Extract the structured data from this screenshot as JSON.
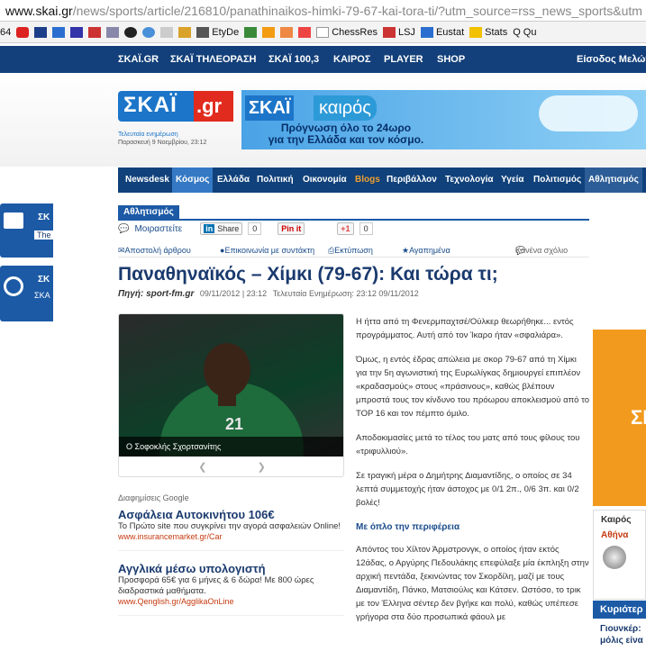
{
  "browser": {
    "url_host": "www.skai.gr",
    "url_path": "/news/sports/article/216810/panathinaikos-himki-79-67-kai-tora-ti/?utm_source=rss_news_sports&utm",
    "bookmarks": [
      "64",
      "EtyDe",
      "ChessRes",
      "LSJ",
      "Eustat",
      "Stats",
      "Qu"
    ]
  },
  "topnav": {
    "items": [
      "ΣΚΑΪ.GR",
      "ΣΚΑΪ ΤΗΛΕΟΡΑΣΗ",
      "ΣΚΑΪ 100,3",
      "ΚΑΙΡΟΣ",
      "PLAYER",
      "SHOP"
    ],
    "login": "Είσοδος Μελών"
  },
  "header": {
    "logo_main": "ΣΚΑΪ",
    "logo_suffix": ".gr",
    "updated_label": "Τελευταία ενημέρωση",
    "updated_value": "Παρασκευή 9 Νοεμβρίου, 23:12",
    "banner_brand": "ΣΚΑΪ",
    "banner_weather": "καιρός",
    "banner_line1": "Πρόγνωση όλο το 24ωρο",
    "banner_line2": "για την Ελλάδα και τον κόσμο."
  },
  "secnav": {
    "items": [
      "Newsdesk",
      "Κόσμος",
      "Ελλάδα",
      "Πολιτική",
      "Οικονομία",
      "Blogs",
      "Περιβάλλον",
      "Τεχνολογία",
      "Υγεία",
      "Πολιτισμός",
      "Αθλητισμός"
    ]
  },
  "article": {
    "section": "Αθλητισμός",
    "share": {
      "share_label": "Μοιραστείτε",
      "linkedin": "Share",
      "linkedin_count": "0",
      "pinit": "Pin it",
      "gplus": "+1",
      "gplus_count": "0"
    },
    "actions": {
      "send": "Αποστολή άρθρου",
      "contact": "Επικοινωνία με συντάκτη",
      "print": "Εκτύπωση",
      "favorites": "Αγαπημένα",
      "comments": "Κανένα σχόλιο"
    },
    "title": "Παναθηναϊκός – Χίμκι (79-67): Και τώρα τι;",
    "source": "Πηγή: sport-fm.gr",
    "date": "09/11/2012",
    "time": "23:12",
    "updated": "Τελευταία Ενημέρωση: 23:12 09/11/2012",
    "photo_caption": "Ο Σοφοκλής Σχορτσανίτης",
    "paragraphs": [
      "Η ήττα από τη Φενερμπαχτσέ/Ούλκερ θεωρήθηκε... εντός προγράμματος. Αυτή από τον Ίκαρο ήταν «σφαλιάρα».",
      "Όμως, η εντός έδρας απώλεια με σκορ 79-67 από τη Χίμκι για την 5η αγωνιστική της Ευρωλίγκας δημιουργεί επιπλέον «κραδασμούς» στους «πράσινους», καθώς βλέπουν μπροστά τους τον κίνδυνο του πρόωρου αποκλεισμού από το TOP 16 και τον πέμπτο όμιλο.",
      "Αποδοκιμασίες μετά το τέλος του ματς από τους φίλους του «τριφυλλιού».",
      "Σε τραγική μέρα ο Δημήτρης Διαμαντίδης, ο οποίος σε 34 λεπτά συμμετοχής ήταν άστοχος με 0/1 2π., 0/6 3π. και 0/2 βολές!"
    ],
    "subheading": "Με όπλο την περιφέρεια",
    "paragraph_last": "Απόντος του Χίλτον Άρμστρονγκ, ο οποίος ήταν εκτός 12άδας, ο Αργύρης Πεδουλάκης επεφύλαξε μία έκπληξη στην αρχική πεντάδα, ξεκινώντας τον Σκορδίλη, μαζί με τους Διαμαντίδη, Πάνκο, Ματσιούλις και Κάτσεν. Ωστόσο, το τρικ με τον Έλληνα σέντερ δεν βγήκε και πολύ, καθώς υπέπεσε γρήγορα στα δύο προσωπικά φάουλ με"
  },
  "ads": {
    "label": "Διαφημίσεις Google",
    "items": [
      {
        "title": "Ασφάλεια Αυτοκινήτου 106€",
        "text": "Το Πρώτο site που συγκρίνει την αγορά ασφαλειών Online!",
        "url": "www.insurancemarket.gr/Car"
      },
      {
        "title": "Αγγλικά μέσω υπολογιστή",
        "text": "Προσφορά 65€ για 6 μήνες & 6 δώρα! Με 800 ώρες διαδραστικά μαθήματα.",
        "url": "www.Qenglish.gr/AgglikaOnLine"
      }
    ]
  },
  "sidebar": {
    "box1": "ΣΚ",
    "box1_sub": "The",
    "box2": "ΣΚ",
    "box2_sub": "ΣΚΑ",
    "big": "ΣΗ",
    "weather_title": "Καιρός",
    "weather_city": "Αθήνα",
    "current_title": "Κυριότερ",
    "current_text1": "Γιουνκέρ:",
    "current_text2": "μόλις είνα"
  }
}
